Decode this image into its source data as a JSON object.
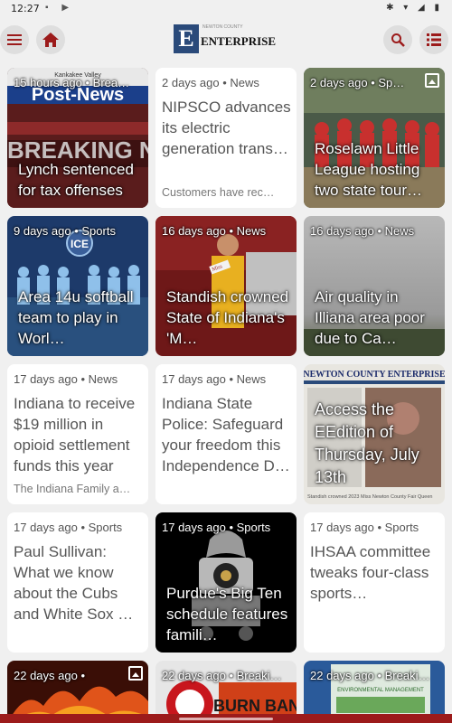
{
  "status": {
    "time": "12:27",
    "left_icons": "▪ ▶",
    "right_icons": "✱ ▾ ◢ ▮"
  },
  "header": {
    "logo_letter": "E",
    "logo_text": "ENTERPRISE",
    "logo_small": "NEWTON COUNTY"
  },
  "cards": [
    {
      "meta": "15 hours ago • Brea…",
      "title": "Lynch sentenced for tax offenses",
      "excerpt": "",
      "image": true,
      "gallery": false
    },
    {
      "meta": "2 days ago • News",
      "title": "NIPSCO advances its electric generation trans…",
      "excerpt": "Customers have rec…",
      "image": false,
      "gallery": false
    },
    {
      "meta": "2 days ago • Sp…",
      "title": "Roselawn Little League hosting two state tour…",
      "excerpt": "",
      "image": true,
      "gallery": true
    },
    {
      "meta": "9 days ago • Sports",
      "title": "Area 14u softball team to play in Worl…",
      "excerpt": "",
      "image": true,
      "gallery": false
    },
    {
      "meta": "16 days ago • News",
      "title": "Standish crowned State of Indiana's 'M…",
      "excerpt": "",
      "image": true,
      "gallery": false
    },
    {
      "meta": "16 days ago • News",
      "title": "Air quality in Illiana area poor due to Ca…",
      "excerpt": "",
      "image": true,
      "gallery": false
    },
    {
      "meta": "17 days ago • News",
      "title": "Indiana to receive $19 million in opioid settlement funds this year",
      "excerpt": "The Indiana Family a…",
      "image": false,
      "gallery": false
    },
    {
      "meta": "17 days ago • News",
      "title": "Indiana State Police: Safeguard your freedom this Independence D…",
      "excerpt": "",
      "image": false,
      "gallery": false
    },
    {
      "meta": "",
      "title": "Access the EEdition of Thursday, July 13th",
      "excerpt": "",
      "image": true,
      "gallery": false
    },
    {
      "meta": "17 days ago • Sports",
      "title": "Paul Sullivan: What we know about the Cubs and White Sox …",
      "excerpt": "",
      "image": false,
      "gallery": false
    },
    {
      "meta": "17 days ago • Sports",
      "title": "Purdue's Big Ten schedule features famili…",
      "excerpt": "",
      "image": true,
      "gallery": false
    },
    {
      "meta": "17 days ago • Sports",
      "title": "IHSAA committee tweaks four-class sports…",
      "excerpt": "",
      "image": false,
      "gallery": false
    },
    {
      "meta": "22 days ago •",
      "title": "",
      "excerpt": "",
      "image": true,
      "gallery": true
    },
    {
      "meta": "22 days ago • Breaki…",
      "title": "",
      "excerpt": "",
      "image": true,
      "gallery": false
    },
    {
      "meta": "22 days ago • Breaki…",
      "title": "",
      "excerpt": "",
      "image": true,
      "gallery": false
    }
  ],
  "image_labels": {
    "c0_banner": "Kankakee Valley",
    "c0_brand": "Post-News",
    "c0_break": "BREAKING NEWS",
    "c3_team": "ICE",
    "c4_sash": "Miss",
    "c8_masthead": "NEWTON COUNTY ENTERPRISE",
    "c8_caption": "Standish crowned 2023 Miss Newton County Fair Queen",
    "c13_sign": "BURN BAN",
    "c14_banner": "ENVIRONMENTAL MANAGEMENT"
  },
  "colors": {
    "accent": "#9c1b1b",
    "logo": "#2a4a7a"
  }
}
